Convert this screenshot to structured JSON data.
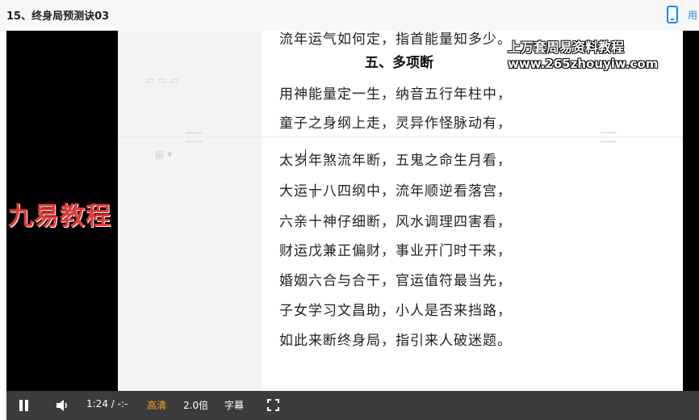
{
  "window": {
    "title": "15、终身局预测诀03",
    "top_right_text": "用"
  },
  "document": {
    "partial_line": "流年运气如何定，指首能量知多少。",
    "heading": "五、多项断",
    "verses": [
      "用神能量定一生，纳音五行年柱中，",
      "童子之身纲上走，灵异作怪脉动有，",
      "太岁年煞流年断，五鬼之命生月看，",
      "大运十八四纲中，流年顺逆看落宫，",
      "六亲十神仔细断，风水调理四害看，",
      "财运戊兼正偏财，事业开门时干来，",
      "婚姻六合与合干，官运值符最当先，",
      "子女学习文昌助，小人是否来挡路，",
      "如此来断终身局，指引来人破迷题。"
    ],
    "cursor_glyph": "I"
  },
  "watermarks": {
    "top": "上万套周易资料教程",
    "url": "www.265zhouyiw.com",
    "brand": "九易教程"
  },
  "controls": {
    "time": "1:24 / -:-",
    "quality": "高清",
    "speed": "2.0倍",
    "subtitles": "字幕"
  },
  "colors": {
    "brand_red": "#e53935",
    "quality_accent": "#f5a623",
    "control_bar": "#3c3c3c",
    "icon_blue": "#1e88e5"
  }
}
